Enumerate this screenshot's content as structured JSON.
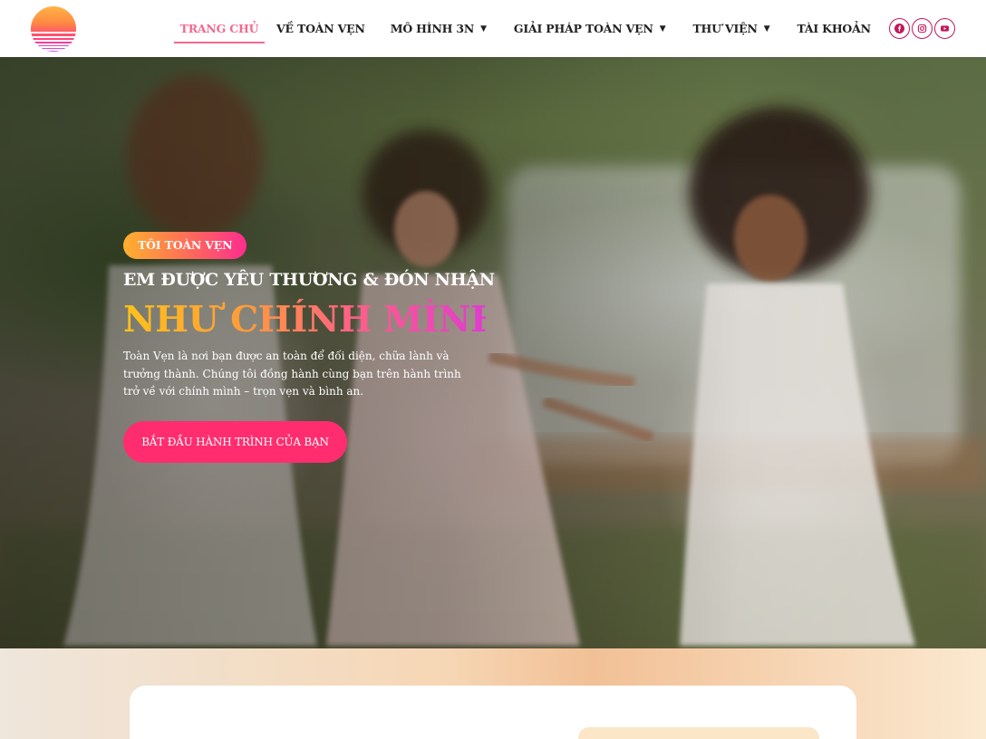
{
  "header": {
    "logo_icon": "sunset-logo-icon",
    "nav": [
      {
        "label": "TRANG CHỦ",
        "active": true,
        "dropdown": false
      },
      {
        "label": "VỀ TOÀN VẸN",
        "active": false,
        "dropdown": false
      },
      {
        "label": "MÔ HÌNH 3N",
        "active": false,
        "dropdown": true
      },
      {
        "label": "GIẢI PHÁP TOÀN VẸN",
        "active": false,
        "dropdown": true
      },
      {
        "label": "THƯ VIỆN",
        "active": false,
        "dropdown": true
      },
      {
        "label": "TÀI KHOẢN",
        "active": false,
        "dropdown": false
      }
    ],
    "social": [
      {
        "icon": "facebook-icon"
      },
      {
        "icon": "instagram-icon"
      },
      {
        "icon": "youtube-icon"
      }
    ]
  },
  "hero": {
    "badge": "TÔI TOÀN VẸN",
    "subtitle": "EM ĐƯỢC YÊU THƯƠNG & ĐÓN NHẬN",
    "title": "NHƯ CHÍNH MÌNH",
    "description": "Toàn Vẹn là nơi bạn được an toàn để đối diện, chữa lành và trưởng thành. Chúng tôi đồng hành cùng bạn trên hành trình trở về với chính mình – trọn vẹn và bình an.",
    "cta": "BẮT ĐẦU HÀNH TRÌNH CỦA BẠN"
  },
  "colors": {
    "accent": "#f2698f",
    "cta": "#ff2d6f",
    "social_border": "#c2185b"
  }
}
